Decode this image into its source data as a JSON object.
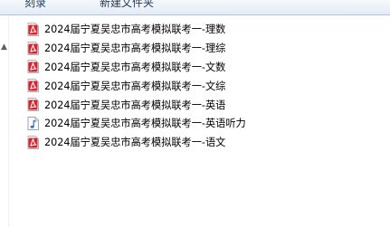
{
  "toolbar": {
    "burn_label": "刻录",
    "new_folder_label": "新建文件夹"
  },
  "files": [
    {
      "name": "2024届宁夏吴忠市高考模拟联考一-理数",
      "icon": "pdf-icon"
    },
    {
      "name": "2024届宁夏吴忠市高考模拟联考一-理综",
      "icon": "pdf-icon"
    },
    {
      "name": "2024届宁夏吴忠市高考模拟联考一-文数",
      "icon": "pdf-icon"
    },
    {
      "name": "2024届宁夏吴忠市高考模拟联考一-文综",
      "icon": "pdf-icon"
    },
    {
      "name": "2024届宁夏吴忠市高考模拟联考一-英语",
      "icon": "pdf-icon"
    },
    {
      "name": "2024届宁夏吴忠市高考模拟联考一-英语听力",
      "icon": "audio-file-icon"
    },
    {
      "name": "2024届宁夏吴忠市高考模拟联考一-语文",
      "icon": "pdf-icon"
    }
  ],
  "colors": {
    "pdf_accent": "#d9232e",
    "audio_accent": "#2a6fc9",
    "toolbar_text": "#1e395b"
  }
}
